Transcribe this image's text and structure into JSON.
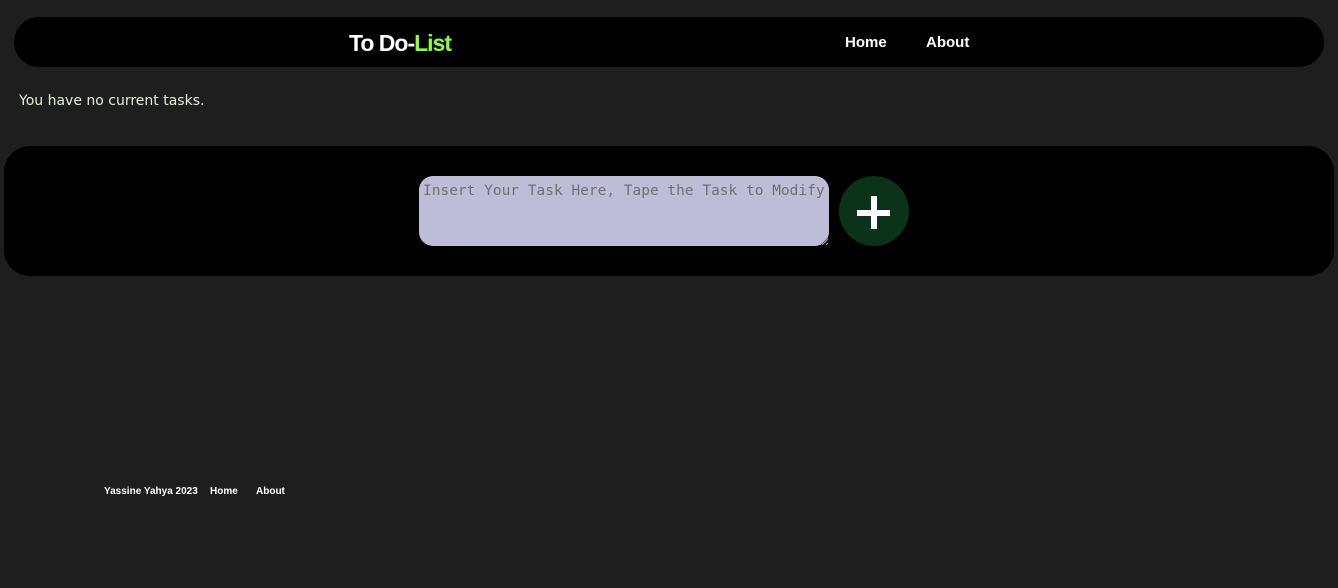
{
  "navbar": {
    "brand_main": "To Do-",
    "brand_accent": "List",
    "links": [
      {
        "label": "Home"
      },
      {
        "label": "About"
      }
    ]
  },
  "status": {
    "empty_message": "You have no current tasks."
  },
  "task_form": {
    "input_value": "",
    "input_placeholder": "Insert Your Task Here, Tape the Task to Modify",
    "add_icon": "plus-icon"
  },
  "footer": {
    "copyright": "Yassine Yahya 2023",
    "links": [
      {
        "label": "Home"
      },
      {
        "label": "About"
      }
    ]
  },
  "colors": {
    "background": "#1e1e1e",
    "panel": "#000000",
    "accent": "#8dff3a",
    "input_bg": "#bebdd8",
    "add_button": "#0b3319"
  }
}
